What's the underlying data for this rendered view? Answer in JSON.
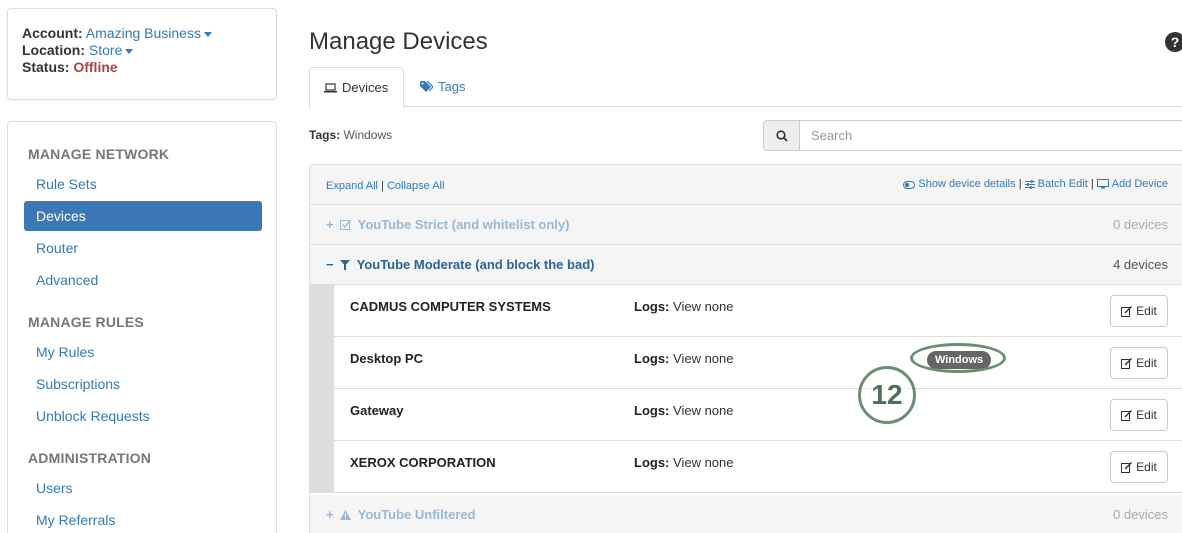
{
  "account": {
    "account_label": "Account:",
    "account_value": "Amazing Business",
    "location_label": "Location:",
    "location_value": "Store",
    "status_label": "Status:",
    "status_value": "Offline"
  },
  "sidebar": {
    "sections": [
      {
        "heading": "MANAGE NETWORK",
        "items": [
          "Rule Sets",
          "Devices",
          "Router",
          "Advanced"
        ]
      },
      {
        "heading": "MANAGE RULES",
        "items": [
          "My Rules",
          "Subscriptions",
          "Unblock Requests"
        ]
      },
      {
        "heading": "ADMINISTRATION",
        "items": [
          "Users",
          "My Referrals"
        ]
      }
    ],
    "active_item": "Devices"
  },
  "page": {
    "title": "Manage Devices",
    "help_icon": "?",
    "tabs": [
      {
        "label": "Devices",
        "icon": "laptop-icon",
        "active": true
      },
      {
        "label": "Tags",
        "icon": "tags-icon",
        "active": false
      }
    ]
  },
  "filter": {
    "tags_label": "Tags:",
    "tags_value": "Windows",
    "search_placeholder": "Search"
  },
  "panel": {
    "expand_all": "Expand All",
    "separator": "|",
    "collapse_all": "Collapse All",
    "show_details": "Show device details",
    "batch_edit": "Batch Edit",
    "add_device": "Add Device"
  },
  "groups": [
    {
      "title": "YouTube Strict (and whitelist only)",
      "count": "0 devices",
      "toggle": "+",
      "icon": "check-square-icon",
      "expanded": false
    },
    {
      "title": "YouTube Moderate (and block the bad)",
      "count": "4 devices",
      "toggle": "−",
      "icon": "filter-icon",
      "expanded": true
    },
    {
      "title": "YouTube Unfiltered",
      "count": "0 devices",
      "toggle": "+",
      "icon": "warning-icon",
      "expanded": false
    }
  ],
  "devices": [
    {
      "name": "CADMUS COMPUTER SYSTEMS",
      "logs_label": "Logs:",
      "logs_value": "View none",
      "tag": ""
    },
    {
      "name": "Desktop PC",
      "logs_label": "Logs:",
      "logs_value": "View none",
      "tag": "Windows"
    },
    {
      "name": "Gateway",
      "logs_label": "Logs:",
      "logs_value": "View none",
      "tag": ""
    },
    {
      "name": "XEROX CORPORATION",
      "logs_label": "Logs:",
      "logs_value": "View none",
      "tag": ""
    }
  ],
  "edit_label": "Edit",
  "callout_number": "12",
  "colors": {
    "accent": "#3b78b5",
    "link": "#337ab7",
    "offline": "#a94442",
    "annotation": "#6a8f73"
  }
}
